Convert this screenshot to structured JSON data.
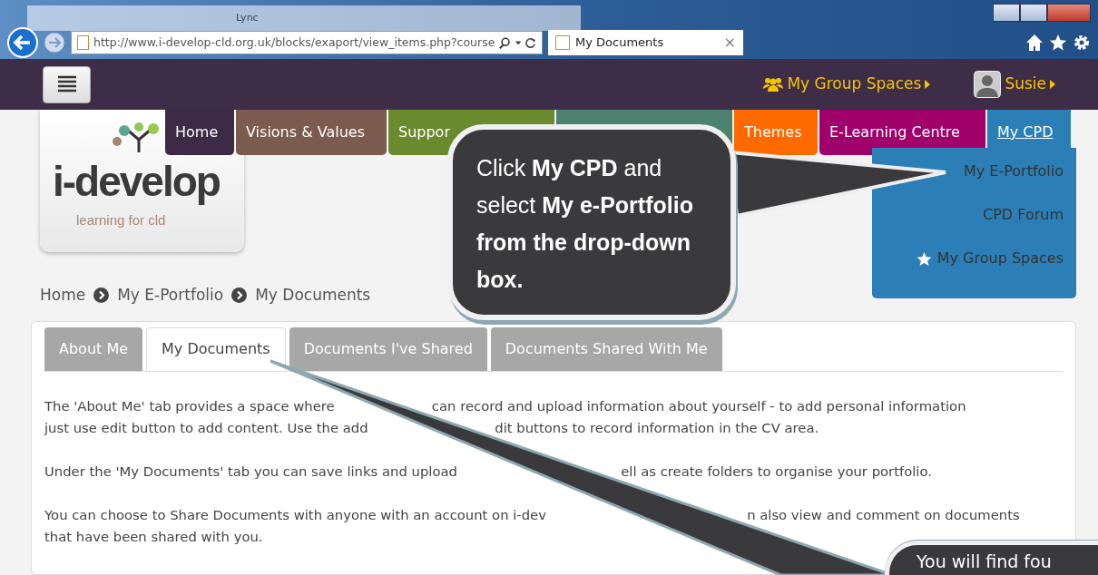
{
  "browser": {
    "background_window_title": "Lync",
    "address": "http://www.i-develop-cld.org.uk/blocks/exaport/view_items.php?course",
    "tab": {
      "title": "My Documents",
      "close": "×"
    }
  },
  "header": {
    "group_spaces": "My Group Spaces",
    "user": "Susie"
  },
  "nav": [
    {
      "label": "Home",
      "color": "#3d2b45",
      "selected": false
    },
    {
      "label": "Visions & Values",
      "color": "#7a5b4d",
      "selected": false
    },
    {
      "label": "Suppor",
      "color": "#6b8a2e",
      "selected": false
    },
    {
      "color": "#4d8170"
    },
    {
      "label": "Themes",
      "color": "#ff6a00",
      "selected": false
    },
    {
      "label": "E-Learning Centre",
      "color": "#a0006a",
      "selected": false
    },
    {
      "label": "My CPD",
      "color": "#2b7fb6",
      "selected": true
    }
  ],
  "nav_dropdown": [
    {
      "label": "My E-Portfolio",
      "kind": "link"
    },
    {
      "label": "CPD Forum",
      "kind": "link"
    },
    {
      "label": "My Group Spaces",
      "kind": "starred"
    }
  ],
  "logo": {
    "name": "i-develop",
    "tagline": "learning for cld"
  },
  "breadcrumb": [
    "Home",
    "My E-Portfolio",
    "My Documents"
  ],
  "tabs": [
    {
      "label": "About Me",
      "selected": false
    },
    {
      "label": "My Documents",
      "selected": true
    },
    {
      "label": "Documents I've Shared",
      "selected": false
    },
    {
      "label": "Documents Shared With Me",
      "selected": false
    }
  ],
  "paragraphs": [
    [
      [
        "The 'About Me' tab provides a space where",
        "can record and upload information about yourself - to add personal information"
      ],
      [
        "just use edit button to add content. Use the add",
        "dit buttons to record information in the CV area."
      ]
    ],
    [
      [
        "Under the 'My Documents' tab you can save links and upload",
        "ell as create folders to organise your portfolio."
      ]
    ],
    [
      [
        "You can choose to Share Documents with anyone with an account on i-dev",
        "n also view and comment on documents"
      ],
      [
        "that have been shared with you."
      ]
    ]
  ],
  "callouts": [
    {
      "text": "Click **My CPD** and select **My e-Portfolio from the drop-down box.**"
    },
    {
      "text": "You will find fou"
    }
  ]
}
